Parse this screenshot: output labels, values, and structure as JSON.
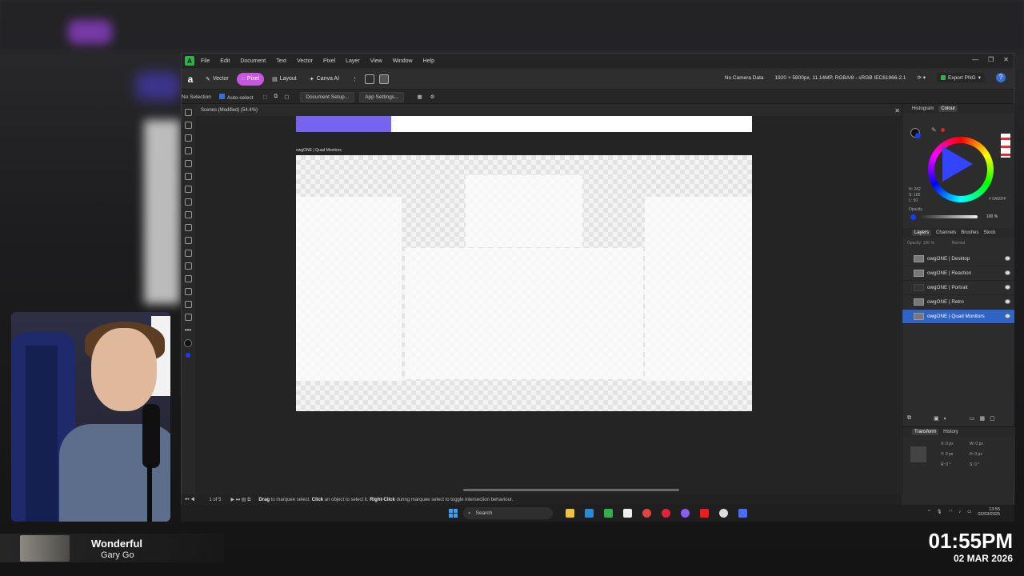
{
  "menu": [
    "File",
    "Edit",
    "Document",
    "Text",
    "Vector",
    "Pixel",
    "Layer",
    "View",
    "Window",
    "Help"
  ],
  "toolbar": {
    "personas": [
      "Vector",
      "Pixel",
      "Layout",
      "Canva AI"
    ],
    "camera": "No Camera Data",
    "doc_info": "1920 × 5800px, 11.14MP, RGBA/8 - sRGB IEC61966-2.1",
    "export": "Export PNG"
  },
  "context": {
    "selection": "No Selection",
    "autoselect": "Auto-select",
    "doc_setup": "Document Setup...",
    "app_settings": "App Settings..."
  },
  "doc_tab": "Scenes (Modified) (54.4%)",
  "artboard_label": "owgONE | Quad Monitors",
  "statusbar": {
    "page": "1 of 5",
    "hint_drag": "Drag",
    "hint_1": " to marquee select. ",
    "hint_click": "Click",
    "hint_2": " an object to select it. ",
    "hint_right": "Right-Click",
    "hint_3": " during marquee select to toggle intersection behaviour."
  },
  "panels": {
    "top_tabs": [
      "Histogram",
      "Colour"
    ],
    "colour_values": {
      "h": "H: 242",
      "s": "S: 100",
      "l": "L: 50",
      "hex": "0A00FF",
      "opacity_label": "Opacity",
      "opacity": "100 %"
    },
    "layer_tabs": [
      "Layers",
      "Channels",
      "Brushes",
      "Stock"
    ],
    "layer_opts": {
      "opacity": "Opacity: 100 %",
      "blend": "Normal"
    },
    "layers": [
      {
        "name": "owgONE | Desktop",
        "selected": false
      },
      {
        "name": "owgONE | Reaction",
        "selected": false
      },
      {
        "name": "owgONE | Portrait",
        "selected": false
      },
      {
        "name": "owgONE | Retro",
        "selected": false
      },
      {
        "name": "owgONE | Quad Monitors",
        "selected": true
      }
    ],
    "bottom_tabs": [
      "Transform",
      "History"
    ],
    "transform": {
      "x": "X: 0 px",
      "y": "Y: 0 px",
      "w": "W: 0 px",
      "h": "H: 0 px",
      "r": "R: 0 °",
      "s": "S: 0 °"
    }
  },
  "taskbar": {
    "search": "Search",
    "tray_time": "13:55",
    "tray_date": "02/03/2026"
  },
  "music": {
    "title": "Wonderful",
    "artist": "Gary Go"
  },
  "clock": {
    "time": "01:55PM",
    "date": "02 MAR 2026"
  },
  "colors": {
    "accent": "#c757e0",
    "selection": "#2f63c4",
    "purple_bar": "#7664ee"
  }
}
